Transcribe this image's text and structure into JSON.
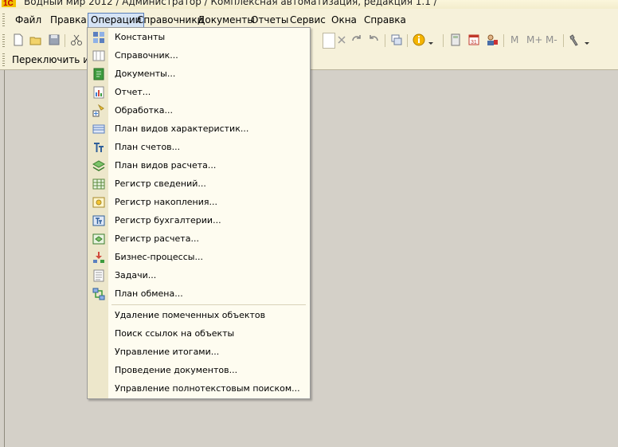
{
  "window": {
    "title": "Водный мир 2012 / Администратор / Комплексная автоматизация, редакция 1.1 /"
  },
  "menubar": {
    "items": [
      {
        "label": "Файл",
        "active": false
      },
      {
        "label": "Правка",
        "active": false
      },
      {
        "label": "Операции",
        "active": true
      },
      {
        "label": "Справочники",
        "active": false
      },
      {
        "label": "Документы",
        "active": false
      },
      {
        "label": "Отчеты",
        "active": false
      },
      {
        "label": "Сервис",
        "active": false
      },
      {
        "label": "Окна",
        "active": false
      },
      {
        "label": "Справка",
        "active": false
      }
    ]
  },
  "toolbar": {
    "buttons": [
      "M",
      "M+",
      "M-"
    ]
  },
  "toolbar2": {
    "label": "Переключить инте"
  },
  "operations_menu": {
    "items": [
      {
        "label": "Константы",
        "icon": "constants-icon"
      },
      {
        "label": "Справочник...",
        "icon": "catalog-icon"
      },
      {
        "label": "Документы...",
        "icon": "documents-icon"
      },
      {
        "label": "Отчет...",
        "icon": "report-icon"
      },
      {
        "label": "Обработка...",
        "icon": "data-processor-icon"
      },
      {
        "label": "План видов характеристик...",
        "icon": "characteristic-types-icon"
      },
      {
        "label": "План счетов...",
        "icon": "chart-of-accounts-icon"
      },
      {
        "label": "План видов расчета...",
        "icon": "calculation-types-icon"
      },
      {
        "label": "Регистр сведений...",
        "icon": "information-register-icon"
      },
      {
        "label": "Регистр накопления...",
        "icon": "accumulation-register-icon"
      },
      {
        "label": "Регистр бухгалтерии...",
        "icon": "accounting-register-icon"
      },
      {
        "label": "Регистр расчета...",
        "icon": "calculation-register-icon"
      },
      {
        "label": "Бизнес-процессы...",
        "icon": "business-processes-icon"
      },
      {
        "label": "Задачи...",
        "icon": "tasks-icon"
      },
      {
        "label": "План обмена...",
        "icon": "exchange-plan-icon"
      }
    ],
    "service_items": [
      {
        "label": "Удаление помеченных объектов"
      },
      {
        "label": "Поиск ссылок на объекты"
      },
      {
        "label": "Управление итогами..."
      },
      {
        "label": "Проведение документов..."
      },
      {
        "label": "Управление полнотекстовым поиском..."
      }
    ]
  }
}
